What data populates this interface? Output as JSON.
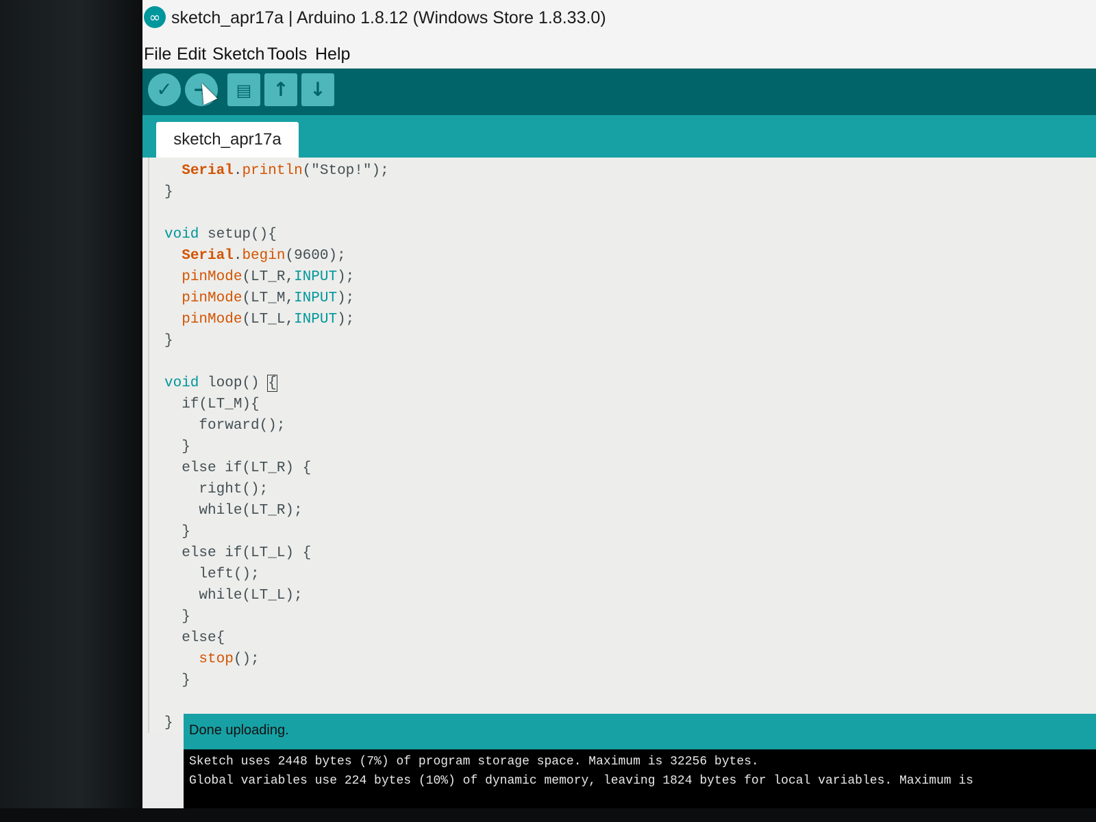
{
  "window": {
    "title": "sketch_apr17a | Arduino 1.8.12 (Windows Store 1.8.33.0)"
  },
  "menu": {
    "items": [
      "File",
      "Edit",
      "Sketch",
      "Tools",
      "Help"
    ]
  },
  "toolbar": {
    "buttons": [
      {
        "name": "verify",
        "icon": "check-icon"
      },
      {
        "name": "upload",
        "icon": "arrow-right-icon"
      },
      {
        "name": "new",
        "icon": "file-icon"
      },
      {
        "name": "open",
        "icon": "arrow-up-icon"
      },
      {
        "name": "save",
        "icon": "arrow-down-icon"
      }
    ]
  },
  "tabs": [
    {
      "label": "sketch_apr17a",
      "active": true
    }
  ],
  "editor": {
    "lines": [
      "  Serial.println(\"Stop!\");",
      "}",
      "",
      "void setup(){",
      "  Serial.begin(9600);",
      "  pinMode(LT_R,INPUT);",
      "  pinMode(LT_M,INPUT);",
      "  pinMode(LT_L,INPUT);",
      "}",
      "",
      "void loop() {",
      "  if(LT_M){",
      "    forward();",
      "  }",
      "  else if(LT_R) {",
      "    right();",
      "    while(LT_R);",
      "  }",
      "  else if(LT_L) {",
      "    left();",
      "    while(LT_L);",
      "  }",
      "  else{",
      "    stop();",
      "  }",
      "",
      "}"
    ]
  },
  "status": {
    "message": "Done uploading."
  },
  "console": {
    "lines": [
      "Sketch uses 2448 bytes (7%) of program storage space. Maximum is 32256 bytes.",
      "Global variables use 224 bytes (10%) of dynamic memory, leaving 1824 bytes for local variables. Maximum is"
    ]
  },
  "colors": {
    "toolbar": "#006468",
    "tabbar": "#17a1a5",
    "keyword_type": "#00979c",
    "keyword_function": "#d35400"
  }
}
